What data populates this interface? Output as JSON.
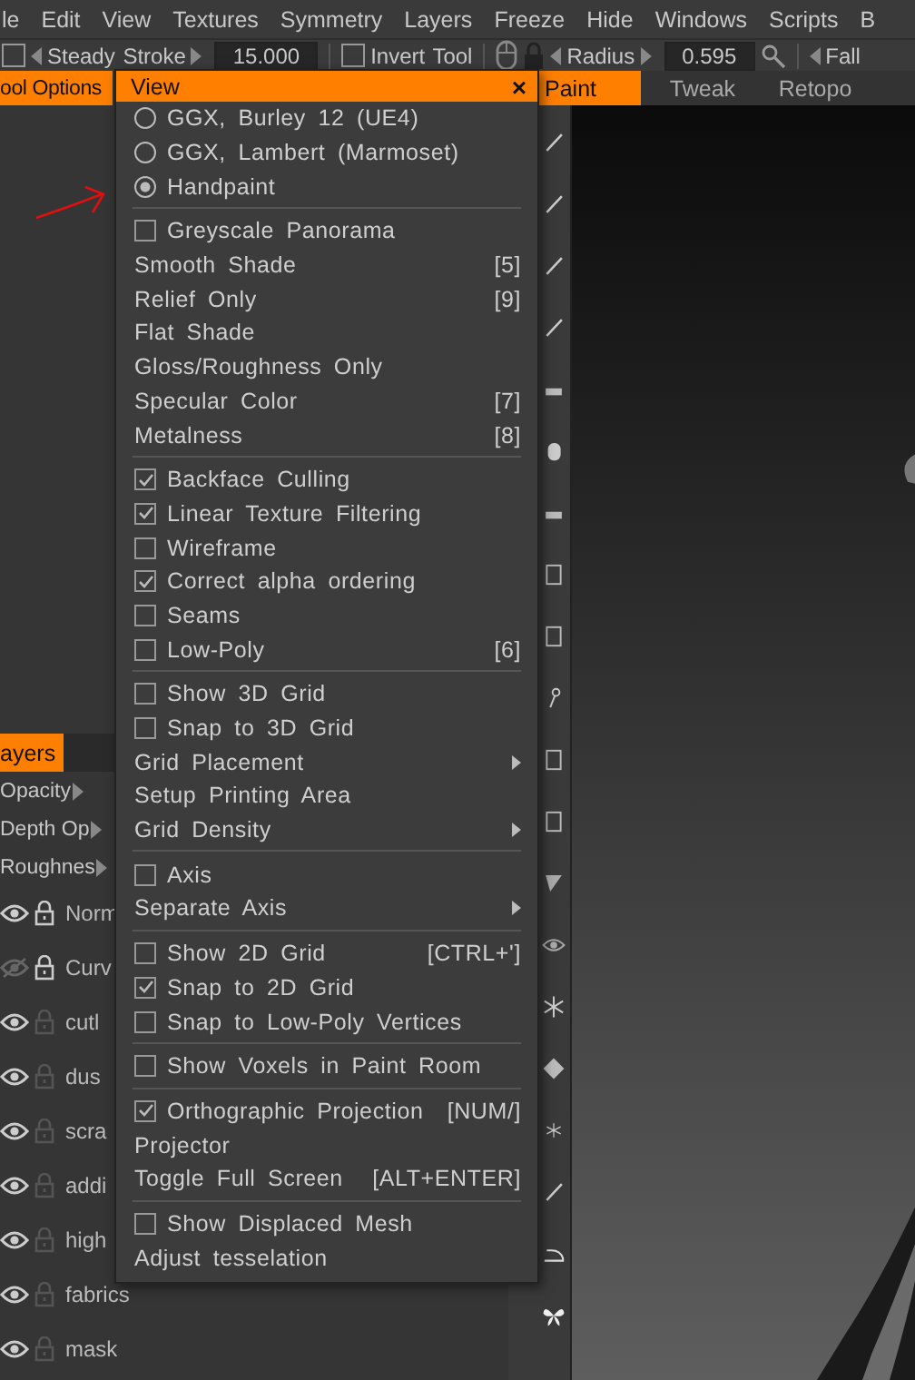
{
  "menubar": [
    "le",
    "Edit",
    "View",
    "Textures",
    "Symmetry",
    "Layers",
    "Freeze",
    "Hide",
    "Windows",
    "Scripts",
    "B"
  ],
  "toolbar": {
    "stroke_toggle": {
      "checked": false
    },
    "steady_stroke": {
      "label": "Steady Stroke",
      "value": "15.000"
    },
    "invert_tool": {
      "label": "Invert Tool",
      "checked": false
    },
    "radius": {
      "label": "Radius",
      "value": "0.595"
    },
    "falloff_label": "Fall"
  },
  "left_panel": {
    "title": "ool Options"
  },
  "room_tabs": [
    {
      "label": "Paint",
      "selected": true
    },
    {
      "label": "Tweak",
      "selected": false
    },
    {
      "label": "Retopo",
      "selected": false
    }
  ],
  "layers_panel": {
    "title": "ayers",
    "params": [
      "Opacity",
      "Depth Op",
      "Roughnes"
    ],
    "layers": [
      {
        "name": "Norm",
        "visible": true,
        "locked": true
      },
      {
        "name": "Curv",
        "visible": false,
        "locked": true
      },
      {
        "name": "cutl",
        "visible": true,
        "locked": false
      },
      {
        "name": "dus",
        "visible": true,
        "locked": false
      },
      {
        "name": "scra",
        "visible": true,
        "locked": false
      },
      {
        "name": "addi",
        "visible": true,
        "locked": false
      },
      {
        "name": "high",
        "visible": true,
        "locked": false
      },
      {
        "name": "fabrics",
        "visible": true,
        "locked": false
      },
      {
        "name": "mask",
        "visible": true,
        "locked": false
      }
    ]
  },
  "view_menu": {
    "title": "View",
    "close": "×",
    "groups": [
      [
        {
          "kind": "radio",
          "label": "GGX, Burley 12 (UE4)",
          "selected": false
        },
        {
          "kind": "radio",
          "label": "GGX, Lambert (Marmoset)",
          "selected": false
        },
        {
          "kind": "radio",
          "label": "Handpaint",
          "selected": true
        }
      ],
      [
        {
          "kind": "check",
          "label": "Greyscale Panorama",
          "checked": false
        },
        {
          "kind": "plain",
          "label": "Smooth Shade",
          "shortcut": "[5]"
        },
        {
          "kind": "plain",
          "label": "Relief Only",
          "shortcut": "[9]"
        },
        {
          "kind": "plain",
          "label": "Flat Shade"
        },
        {
          "kind": "plain",
          "label": "Gloss/Roughness Only"
        },
        {
          "kind": "plain",
          "label": "Specular Color",
          "shortcut": "[7]"
        },
        {
          "kind": "plain",
          "label": "Metalness",
          "shortcut": "[8]"
        }
      ],
      [
        {
          "kind": "check",
          "label": "Backface Culling",
          "checked": true
        },
        {
          "kind": "check",
          "label": "Linear Texture Filtering",
          "checked": true
        },
        {
          "kind": "check",
          "label": "Wireframe",
          "checked": false
        },
        {
          "kind": "check",
          "label": "Correct alpha ordering",
          "checked": true
        },
        {
          "kind": "check",
          "label": "Seams",
          "checked": false
        },
        {
          "kind": "check",
          "label": "Low-Poly",
          "checked": false,
          "shortcut": "[6]"
        }
      ],
      [
        {
          "kind": "check",
          "label": "Show 3D Grid",
          "checked": false
        },
        {
          "kind": "check",
          "label": "Snap to 3D Grid",
          "checked": false
        },
        {
          "kind": "submenu",
          "label": "Grid Placement"
        },
        {
          "kind": "plain",
          "label": "Setup Printing Area"
        },
        {
          "kind": "submenu",
          "label": "Grid Density"
        }
      ],
      [
        {
          "kind": "check",
          "label": "Axis",
          "checked": false
        },
        {
          "kind": "submenu",
          "label": "Separate Axis"
        }
      ],
      [
        {
          "kind": "check",
          "label": "Show 2D Grid",
          "checked": false,
          "shortcut": "[CTRL+']"
        },
        {
          "kind": "check",
          "label": "Snap to 2D Grid",
          "checked": true
        },
        {
          "kind": "check",
          "label": "Snap to Low-Poly Vertices",
          "checked": false
        }
      ],
      [
        {
          "kind": "check",
          "label": "Show Voxels in Paint Room",
          "checked": false
        }
      ],
      [
        {
          "kind": "check",
          "label": "Orthographic Projection",
          "checked": true,
          "shortcut": "[NUM/]"
        },
        {
          "kind": "plain",
          "label": "Projector"
        },
        {
          "kind": "plain",
          "label": "Toggle Full Screen",
          "shortcut": "[ALT+ENTER]"
        }
      ],
      [
        {
          "kind": "check",
          "label": "Show Displaced Mesh",
          "checked": false
        },
        {
          "kind": "plain",
          "label": "Adjust tesselation"
        }
      ]
    ]
  }
}
